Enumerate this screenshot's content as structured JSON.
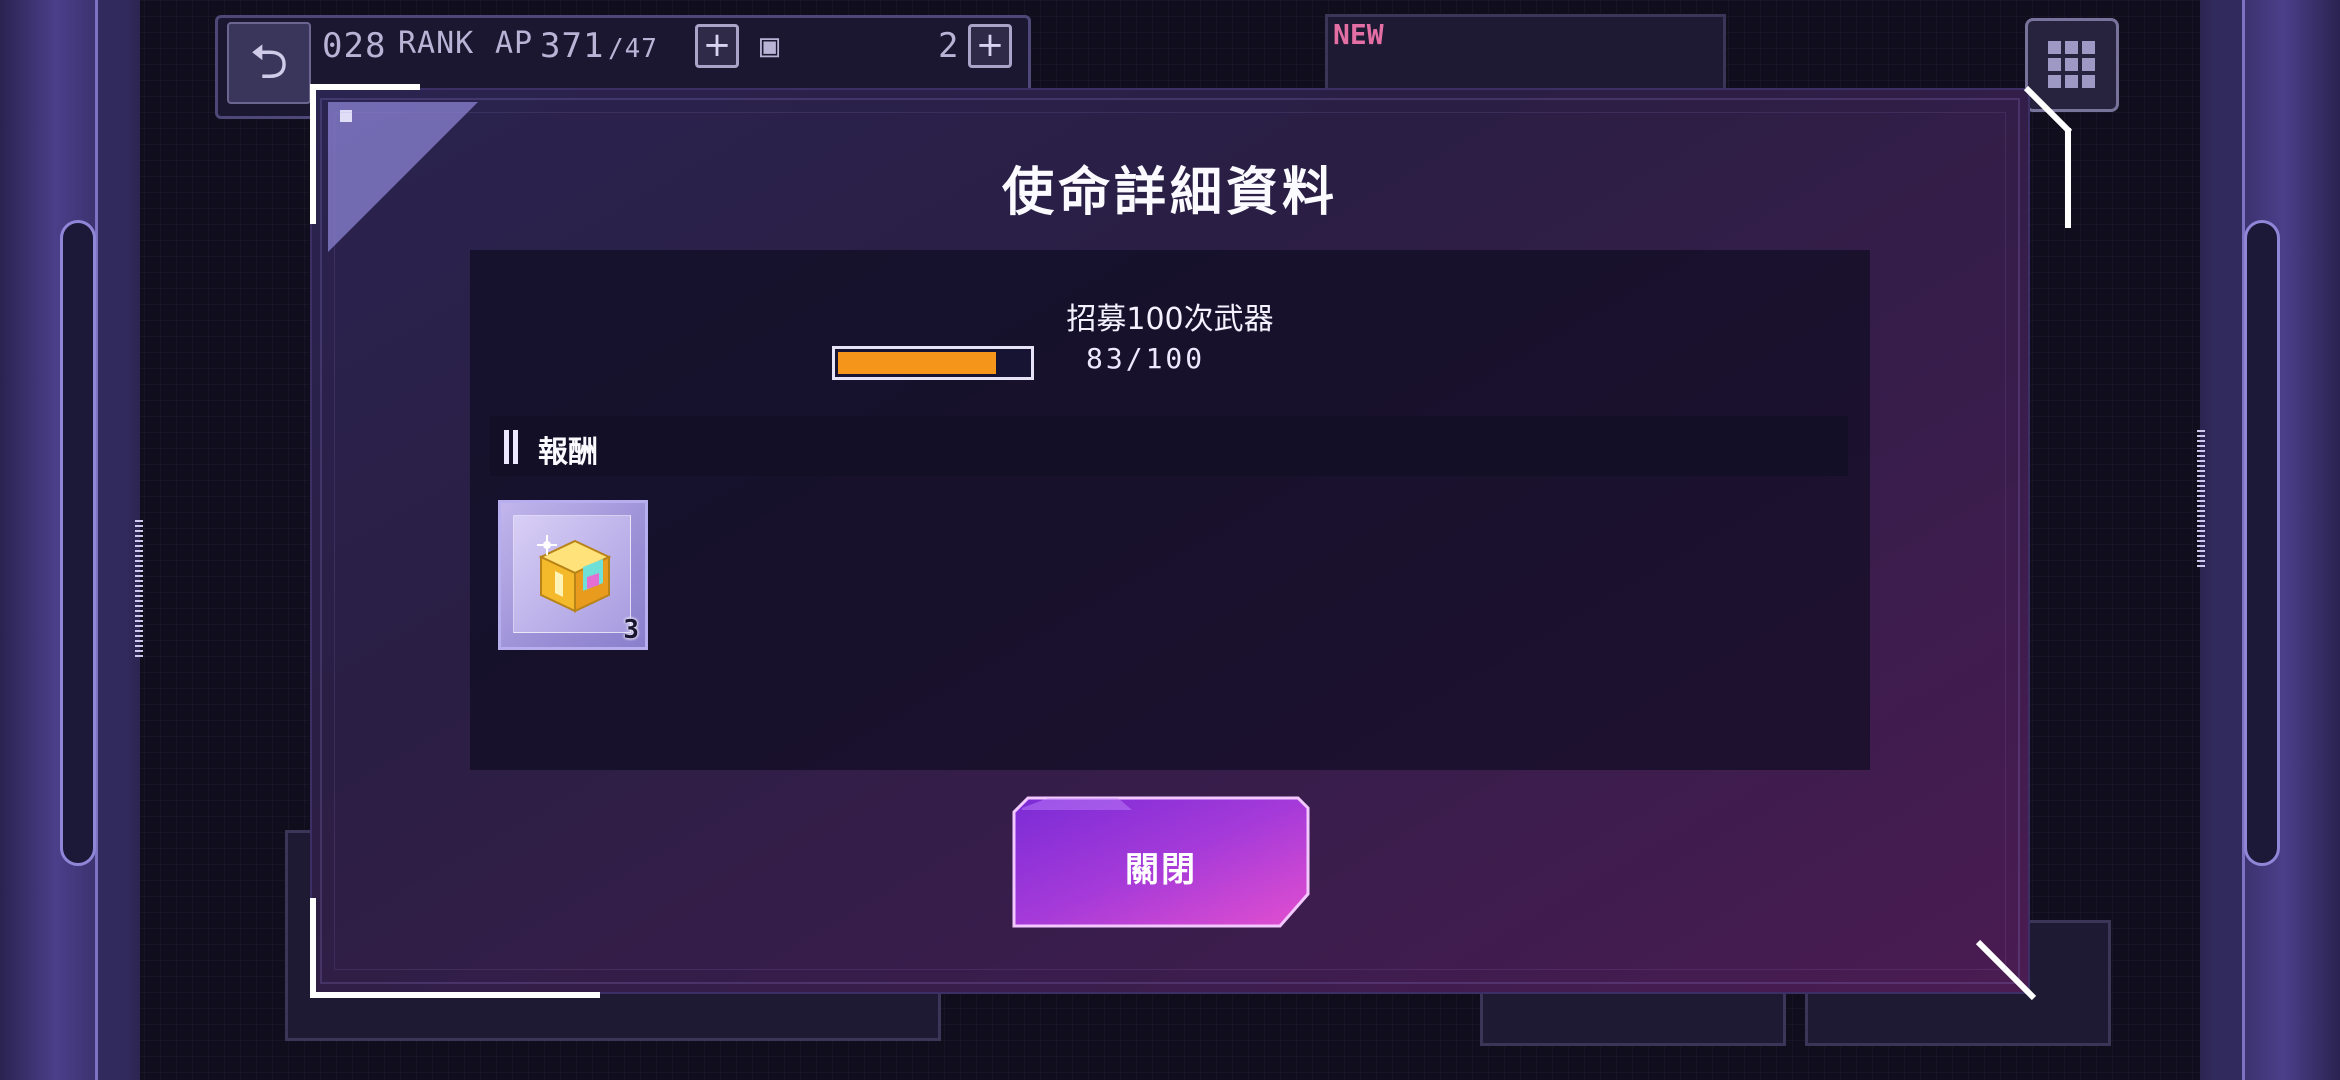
{
  "hud": {
    "rank_value": "028",
    "rank_label": "RANK",
    "ap_label": "AP",
    "ap_value": "371",
    "ap_max": "/47",
    "item_count": "2",
    "new_badge": "NEW"
  },
  "dialog": {
    "title": "使命詳細資料",
    "mission": {
      "description": "招募100次武器",
      "progress_current": 83,
      "progress_max": 100,
      "progress_text": "83/100",
      "progress_color": "#f5951a"
    },
    "rewards": {
      "header": "報酬",
      "items": [
        {
          "icon": "treasure-chest-icon",
          "quantity": "3"
        }
      ]
    },
    "close_button": {
      "label": "關閉",
      "color": "#c43bd2"
    }
  },
  "colors": {
    "accent": "#8c84d4",
    "dialog_bg": "#2a1e44",
    "frame": "#ffffff"
  }
}
